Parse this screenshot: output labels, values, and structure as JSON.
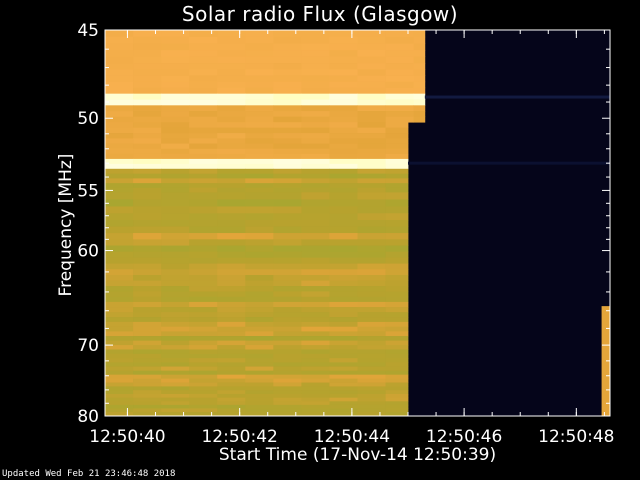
{
  "chart_data": {
    "type": "heatmap",
    "title": "Solar radio Flux (Glasgow)",
    "xlabel": "Start Time (17-Nov-14 12:50:39)",
    "ylabel": "Frequency [MHz]",
    "x_ticks": [
      "12:50:40",
      "12:50:42",
      "12:50:44",
      "12:50:46",
      "12:50:48"
    ],
    "x_tick_values_s": [
      1,
      3,
      5,
      7,
      9
    ],
    "xlim_s": [
      0.6,
      9.6
    ],
    "y_ticks": [
      45,
      50,
      55,
      60,
      70,
      80
    ],
    "ylim": [
      45,
      80
    ],
    "y_scale": "reciprocal",
    "data_end_s": [
      {
        "freq_range": [
          45,
          50
        ],
        "end_s": 6.3
      },
      {
        "freq_range": [
          50,
          80
        ],
        "end_s": 6.0
      }
    ],
    "bright_bands_mhz": [
      48.7,
      53.0
    ],
    "colors": {
      "background": "#000000",
      "no_data": "#05051a",
      "high_flux": "#f8b04e",
      "band_peak": "#fffec0",
      "mid_flux": "#e4a53a",
      "low_flux": "#b9a22e",
      "greenish": "#a9a630"
    }
  },
  "footer": "Updated Wed Feb 21 23:46:48 2018"
}
